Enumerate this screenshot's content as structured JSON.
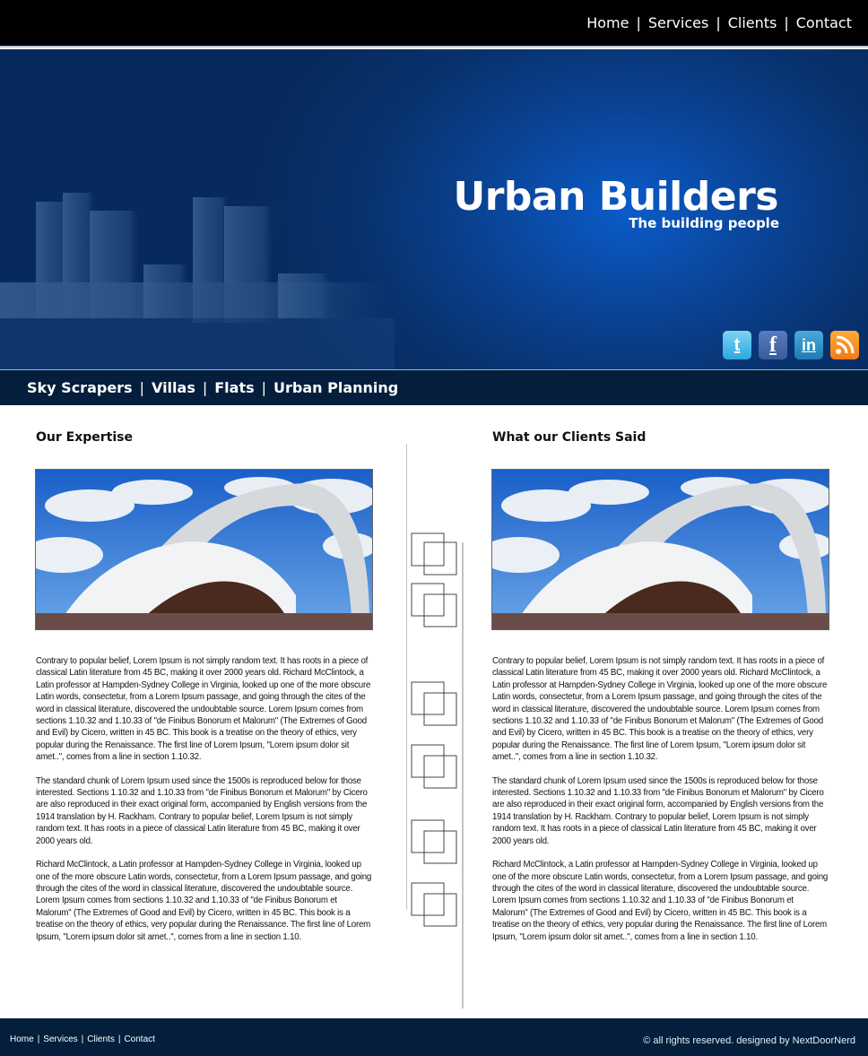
{
  "top_nav": [
    {
      "label": "Home"
    },
    {
      "label": "Services"
    },
    {
      "label": "Clients"
    },
    {
      "label": "Contact"
    }
  ],
  "hero": {
    "title": "Urban Builders",
    "subtitle": "The building people"
  },
  "social": {
    "twitter": "twitter-icon",
    "facebook": "facebook-icon",
    "linkedin": "linkedin-icon",
    "rss": "rss-icon"
  },
  "sub_nav": [
    {
      "label": "Sky Scrapers"
    },
    {
      "label": "Villas"
    },
    {
      "label": "Flats"
    },
    {
      "label": "Urban Planning"
    }
  ],
  "left": {
    "title": "Our Expertise",
    "paragraphs": [
      "Contrary to popular belief, Lorem Ipsum is not simply random text. It has roots in a piece of classical Latin literature from 45 BC, making it over 2000 years old. Richard McClintock, a Latin professor at Hampden-Sydney College in Virginia, looked up one of the more obscure Latin words, consectetur, from a Lorem Ipsum passage, and going through the cites of the word in classical literature, discovered the undoubtable source. Lorem Ipsum comes from sections 1.10.32 and 1.10.33 of \"de Finibus Bonorum et Malorum\" (The Extremes of Good and Evil) by Cicero, written in 45 BC. This book is a treatise on the theory of ethics, very popular during the Renaissance. The first line of Lorem Ipsum, \"Lorem ipsum dolor sit amet..\", comes from a line in section 1.10.32.",
      "The standard chunk of Lorem Ipsum used since the 1500s is reproduced below for those interested. Sections 1.10.32 and 1.10.33 from \"de Finibus Bonorum et Malorum\" by Cicero are also reproduced in their exact original form, accompanied by English versions from the 1914 translation by H. Rackham. Contrary to popular belief, Lorem Ipsum is not simply random text. It has roots in a piece of classical Latin literature from 45 BC, making it over 2000 years old.",
      "Richard McClintock, a Latin professor at Hampden-Sydney College in Virginia, looked up one of the more obscure Latin words, consectetur, from a Lorem Ipsum passage, and going through the cites of the word in classical literature, discovered the undoubtable source. Lorem Ipsum comes from sections 1.10.32 and 1.10.33 of \"de Finibus Bonorum et Malorum\" (The Extremes of Good and Evil) by Cicero, written in 45 BC. This book is a treatise on the theory of ethics, very popular during the Renaissance. The first line of Lorem Ipsum, \"Lorem ipsum dolor sit amet..\", comes from a line in section 1.10."
    ]
  },
  "right": {
    "title": "What our Clients Said",
    "paragraphs": [
      "Contrary to popular belief, Lorem Ipsum is not simply random text. It has roots in a piece of classical Latin literature from 45 BC, making it over 2000 years old. Richard McClintock, a Latin professor at Hampden-Sydney College in Virginia, looked up one of the more obscure Latin words, consectetur, from a Lorem Ipsum passage, and going through the cites of the word in classical literature, discovered the undoubtable source. Lorem Ipsum comes from sections 1.10.32 and 1.10.33 of \"de Finibus Bonorum et Malorum\" (The Extremes of Good and Evil) by Cicero, written in 45 BC. This book is a treatise on the theory of ethics, very popular during the Renaissance. The first line of Lorem Ipsum, \"Lorem ipsum dolor sit amet..\", comes from a line in section 1.10.32.",
      "The standard chunk of Lorem Ipsum used since the 1500s is reproduced below for those interested. Sections 1.10.32 and 1.10.33 from \"de Finibus Bonorum et Malorum\" by Cicero are also reproduced in their exact original form, accompanied by English versions from the 1914 translation by H. Rackham. Contrary to popular belief, Lorem Ipsum is not simply random text. It has roots in a piece of classical Latin literature from 45 BC, making it over 2000 years old.",
      "Richard McClintock, a Latin professor at Hampden-Sydney College in Virginia, looked up one of the more obscure Latin words, consectetur, from a Lorem Ipsum passage, and going through the cites of the word in classical literature, discovered the undoubtable source. Lorem Ipsum comes from sections 1.10.32 and 1.10.33 of \"de Finibus Bonorum et Malorum\" (The Extremes of Good and Evil) by Cicero, written in 45 BC. This book is a treatise on the theory of ethics, very popular during the Renaissance. The first line of Lorem Ipsum, \"Lorem ipsum dolor sit amet..\", comes from a line in section 1.10."
    ]
  },
  "footer": {
    "nav": [
      {
        "label": "Home"
      },
      {
        "label": "Services"
      },
      {
        "label": "Clients"
      },
      {
        "label": "Contact"
      }
    ],
    "copyright": "© all rights reserved. designed by NextDoorNerd"
  },
  "colors": {
    "topbar": "#000000",
    "hero_accent": "#0b5bc9",
    "subnav": "#041e3c",
    "footer": "#041e3c"
  }
}
